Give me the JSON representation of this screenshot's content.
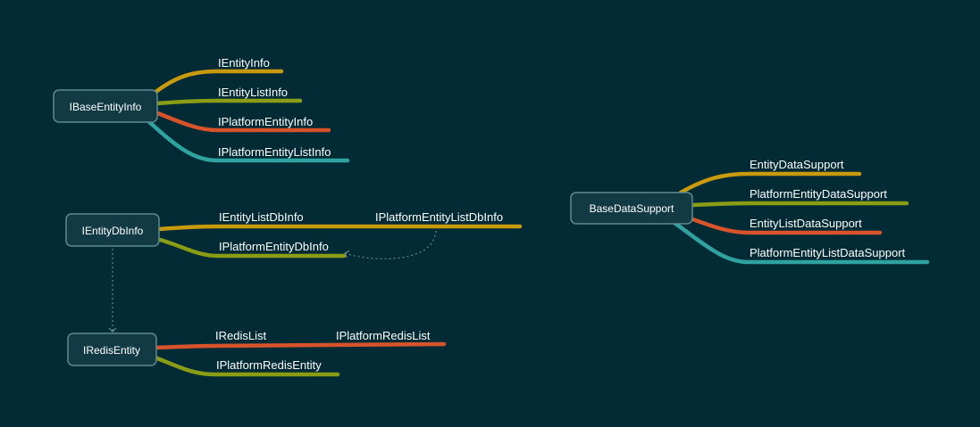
{
  "colors": {
    "background": "#022b36",
    "node_fill": "#123a45",
    "node_border": "#5d8a93",
    "gold": "#c99a0e",
    "olive": "#8a9d15",
    "orange": "#d8532a",
    "teal": "#2ea3a0",
    "relation": "#6f9aa3"
  },
  "topics": {
    "base_entity_info": {
      "label": "IBaseEntityInfo",
      "children": [
        "IEntityInfo",
        "IEntityListInfo",
        "IPlatformEntityInfo",
        "IPlatformEntityListInfo"
      ]
    },
    "entity_db_info": {
      "label": "IEntityDbInfo",
      "children": [
        "IEntityListDbInfo",
        "IPlatformEntityDbInfo"
      ],
      "extension": "IPlatformEntityListDbInfo"
    },
    "redis_entity": {
      "label": "IRedisEntity",
      "children": [
        "IRedisList",
        "IPlatformRedisEntity"
      ],
      "extension": "IPlatformRedisList"
    },
    "base_data_support": {
      "label": "BaseDataSupport",
      "children": [
        "EntityDataSupport",
        "PlatformEntityDataSupport",
        "EntityListDataSupport",
        "PlatformEntityListDataSupport"
      ]
    }
  }
}
